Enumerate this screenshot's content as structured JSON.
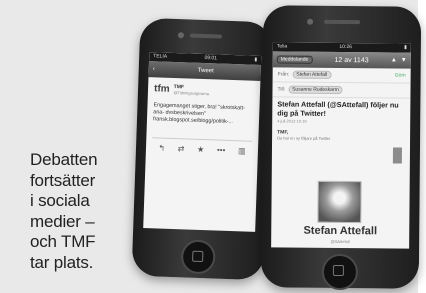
{
  "caption": {
    "lines": [
      "Debatten",
      "fortsätter",
      "i sociala",
      "medier –",
      "och TMF",
      "tar plats."
    ]
  },
  "left_phone": {
    "status": {
      "carrier": "TELIA",
      "time": "09:01",
      "battery": ""
    },
    "nav": {
      "back": "‹",
      "title": "Tweet"
    },
    "tweet": {
      "logo": "tfm",
      "name": "TMF",
      "handle": "@Tidningsutgivarna",
      "body": "Engagemanget stiger, bra! \"skrotskatt- ana- dvsbeskrivelsen\" fransk.blogspot.se/blogg/politik-...",
      "actions": [
        "↰",
        "⇄",
        "★",
        "•••",
        "▥"
      ]
    }
  },
  "right_phone": {
    "status": {
      "carrier": "Telia",
      "time": "10:26",
      "battery": ""
    },
    "nav": {
      "button": "Meddelande",
      "counter": "12 av 1143",
      "up": "▲",
      "down": "▼"
    },
    "from_label": "Från:",
    "from_value": "Stefan Attefall",
    "hide": "Göm",
    "to_label": "Till:",
    "to_value": "Susanne Rudeskarm",
    "subject": "Stefan Attefall (@SAttefall) följer nu dig på Twitter!",
    "date": "4 juli 2012 10:19",
    "brand": "TMF,",
    "brand_sub": "Du har en ny följare på Twitter",
    "profile_name": "Stefan Attefall",
    "profile_handle": "@SAttefall"
  }
}
